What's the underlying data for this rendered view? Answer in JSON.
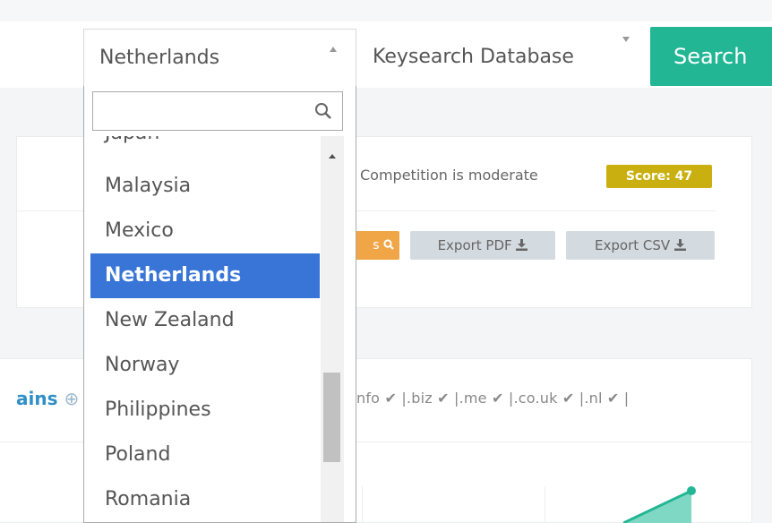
{
  "search_bar": {
    "country_selected": "Netherlands",
    "database_selected": "Keysearch Database",
    "search_button": "Search"
  },
  "country_dropdown": {
    "search_value": "",
    "options": [
      "Japan",
      "Malaysia",
      "Mexico",
      "Netherlands",
      "New Zealand",
      "Norway",
      "Philippines",
      "Poland",
      "Romania"
    ],
    "selected_index": 3
  },
  "overview": {
    "competition_text": "Competition is moderate",
    "score_label": "Score: 47",
    "orange_button_partial": "s",
    "export_pdf": "Export PDF",
    "export_csv": "Export CSV"
  },
  "domains": {
    "heading_partial": "ains",
    "tld_text": "nfo ✔ |.biz ✔ |.me ✔ |.co.uk ✔ |.nl ✔ |"
  },
  "colors": {
    "search_green": "#22b695",
    "selected_blue": "#3875d7",
    "score_yellow": "#c9b010",
    "orange": "#f0a646",
    "link_blue": "#2f8fc6"
  }
}
